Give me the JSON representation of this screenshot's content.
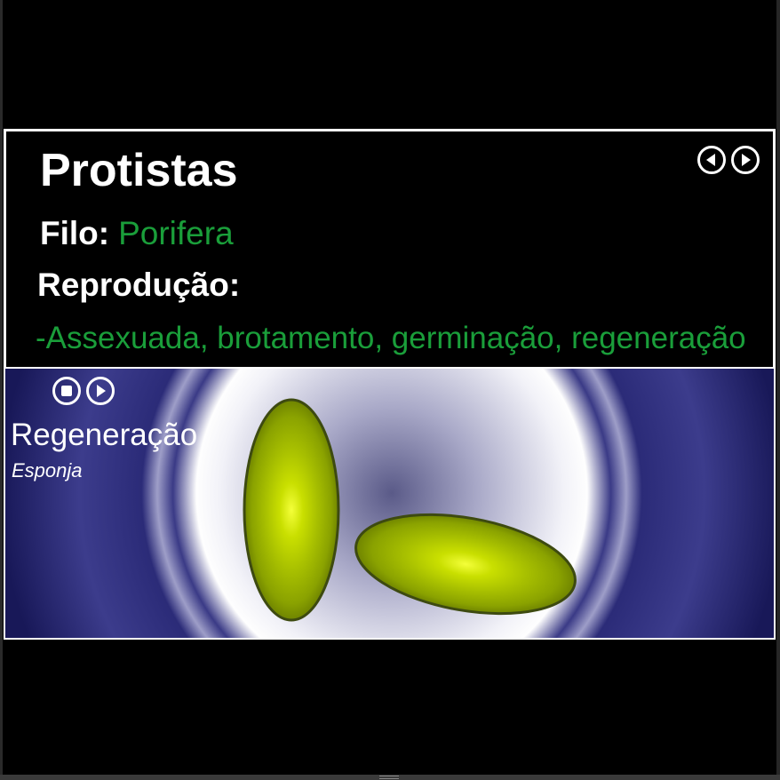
{
  "info": {
    "title": "Protistas",
    "filo_label": "Filo:",
    "filo_value": "Porifera",
    "reproduction_label": "Reprodução:",
    "reproduction_value": "-Assexuada, brotamento, germinação, regeneração"
  },
  "navigation": {
    "previous_icon": "circle-left-arrow-icon",
    "next_icon": "circle-right-arrow-icon"
  },
  "animation": {
    "title": "Regeneração",
    "subtitle": "Esponja",
    "stop_icon": "circle-stop-icon",
    "play_icon": "circle-play-icon"
  },
  "colors": {
    "background": "#000000",
    "border": "#ffffff",
    "green_text": "#1a9e3a",
    "scene_blue": "#1b1b5c",
    "cell_yellow_green": "#b5cc00",
    "cell_outline": "#3d4a10"
  }
}
